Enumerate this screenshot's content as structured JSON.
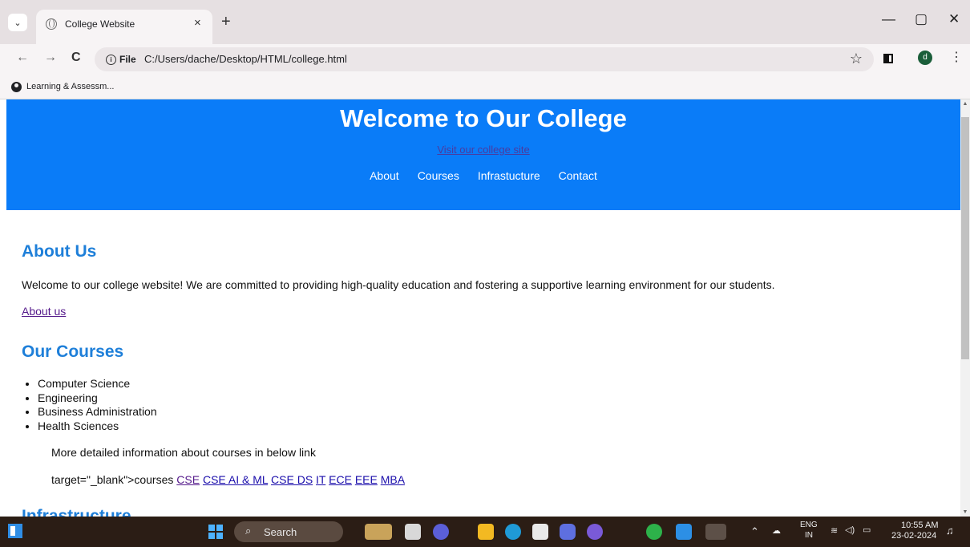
{
  "browser": {
    "tab_title": "College Website",
    "tab_close": "×",
    "new_tab": "+",
    "tab_list": "⌄",
    "back": "←",
    "forward": "→",
    "reload": "C",
    "site_info_label": "File",
    "url": "C:/Users/dache/Desktop/HTML/college.html",
    "bookmark_star": "☆",
    "avatar_letter": "d",
    "menu": "⋮",
    "minimize": "—",
    "restore": "▢",
    "close": "✕",
    "bookmark_item": "Learning & Assessm..."
  },
  "hero": {
    "title": "Welcome to Our College",
    "site_link": "Visit our college site",
    "nav": [
      "About",
      "Courses",
      "Infrastucture",
      "Contact"
    ],
    "bg_color": "#0a7cf8"
  },
  "about": {
    "heading": "About Us",
    "text": "Welcome to our college website! We are committed to providing high-quality education and fostering a supportive learning environment for our students.",
    "link": "About us"
  },
  "courses": {
    "heading": "Our Courses",
    "items": [
      "Computer Science",
      "Engineering",
      "Business Administration",
      "Health Sciences"
    ],
    "more_info": "More detailed information about courses in below link",
    "links_prefix": "target=\"_blank\">courses",
    "links": [
      "CSE",
      "CSE AI & ML",
      "CSE DS",
      "IT",
      "ECE",
      "EEE",
      "MBA"
    ]
  },
  "next_heading": "Infrastructure",
  "taskbar": {
    "search_placeholder": "Search",
    "language": "ENG",
    "region": "IN",
    "time": "10:55 AM",
    "date": "23-02-2024"
  }
}
